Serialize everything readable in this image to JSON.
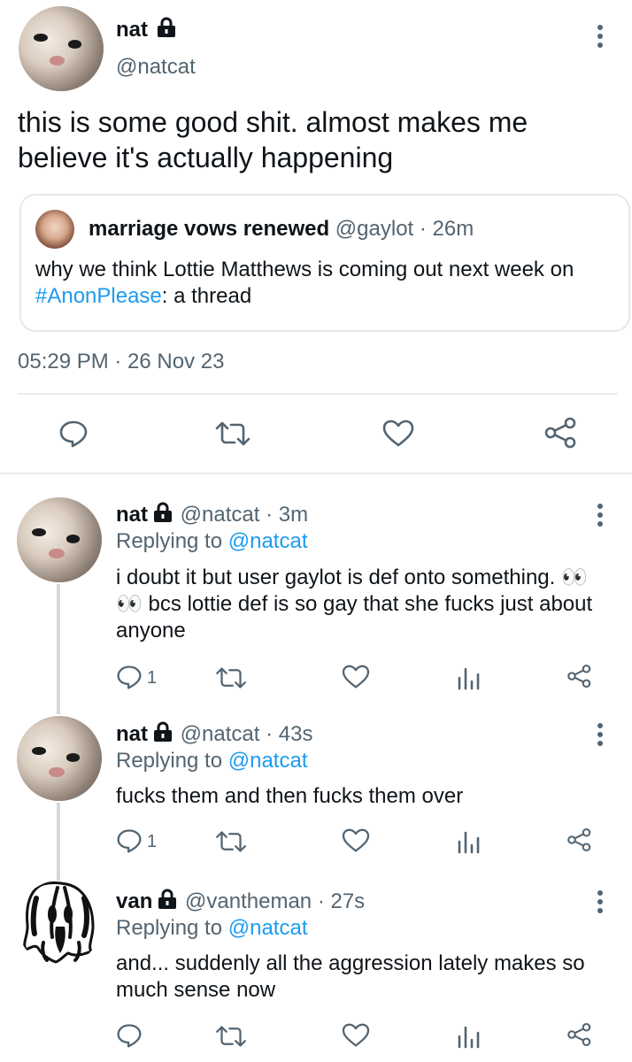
{
  "main_tweet": {
    "author_name": "nat",
    "author_handle": "@natcat",
    "text": "this is some good shit. almost makes me believe it's actually happening",
    "timestamp": "05:29 PM · 26 Nov 23",
    "quoted": {
      "author_name": "marriage vows renewed",
      "author_handle": "@gaylot",
      "time": "26m",
      "text_before": "why we think Lottie Matthews is coming out next week on ",
      "hashtag": "#AnonPlease",
      "text_after": ": a thread"
    }
  },
  "replies": [
    {
      "author_name": "nat",
      "author_handle": "@natcat",
      "time": "3m",
      "replying_prefix": "Replying to",
      "replying_to": "@natcat",
      "text": "i doubt it but user gaylot is def onto something. 👀👀 bcs lottie def is so gay that she fucks just about anyone",
      "reply_count": "1"
    },
    {
      "author_name": "nat",
      "author_handle": "@natcat",
      "time": "43s",
      "replying_prefix": "Replying to",
      "replying_to": "@natcat",
      "text": "fucks them and then fucks them over",
      "reply_count": "1"
    },
    {
      "author_name": "van",
      "author_handle": "@vantheman",
      "time": "27s",
      "replying_prefix": "Replying to",
      "replying_to": "@natcat",
      "text": "and... suddenly all the aggression lately makes so much sense now",
      "reply_count": ""
    }
  ],
  "icons": [
    "lock-icon",
    "kebab-menu-icon",
    "reply-icon",
    "retweet-icon",
    "like-icon",
    "share-icon",
    "analytics-icon"
  ],
  "colors": {
    "link": "#1d9bf0",
    "secondary_text": "#536471",
    "border": "#e1e8ed"
  }
}
